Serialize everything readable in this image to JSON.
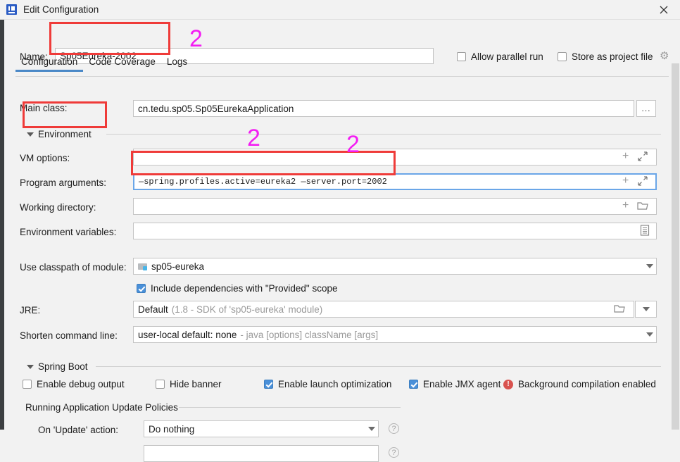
{
  "window": {
    "title": "Edit Configuration",
    "app_icon": "intellij-idea-icon",
    "close_icon": "close-icon"
  },
  "name_row": {
    "label": "Name:",
    "value": "Sp05Eureka-2002"
  },
  "top_options": [
    {
      "label": "Allow parallel run",
      "checked": false
    },
    {
      "label": "Store as project file",
      "checked": false
    }
  ],
  "gear_icon": "gear-icon",
  "tabs": [
    {
      "label": "Configuration",
      "active": true
    },
    {
      "label": "Code Coverage",
      "active": false
    },
    {
      "label": "Logs",
      "active": false
    }
  ],
  "fields": {
    "main_class": {
      "label": "Main class:",
      "value": "cn.tedu.sp05.Sp05EurekaApplication",
      "browse_label": "..."
    },
    "environment_section": {
      "label": "Environment"
    },
    "vm_options": {
      "label": "VM options:",
      "value": ""
    },
    "program_arguments": {
      "label": "Program arguments:",
      "value": "—spring.profiles.active=eureka2  —server.port=2002"
    },
    "working_directory": {
      "label": "Working directory:",
      "value": ""
    },
    "environment_variables": {
      "label": "Environment variables:",
      "value": ""
    },
    "use_classpath": {
      "label": "Use classpath of module:",
      "value": "sp05-eureka"
    },
    "include_dependencies": {
      "label": "Include dependencies with \"Provided\" scope",
      "checked": true
    },
    "jre": {
      "label": "JRE:",
      "value": "Default",
      "hint": "(1.8 - SDK of 'sp05-eureka' module)"
    },
    "shorten_command_line": {
      "label": "Shorten command line:",
      "value": "user-local default: none",
      "hint": "- java [options] className [args]"
    }
  },
  "spring_boot": {
    "section_label": "Spring Boot",
    "checkboxes": [
      {
        "label": "Enable debug output",
        "checked": false
      },
      {
        "label": "Hide banner",
        "checked": false
      },
      {
        "label": "Enable launch optimization",
        "checked": true
      },
      {
        "label": "Enable JMX agent",
        "checked": true
      }
    ],
    "warning": {
      "icon": "error-icon",
      "text": "Background compilation enabled"
    },
    "update_policies": {
      "section_label": "Running Application Update Policies",
      "on_update_label": "On 'Update' action:",
      "on_update_value": "Do nothing"
    }
  },
  "icons": {
    "plus": "+",
    "expand": "expand-icon",
    "folder": "folder-icon",
    "document": "document-icon",
    "dropdown": "chevron-down-icon",
    "help": "help-icon"
  },
  "annotations": {
    "marker_label": "2",
    "markers": [
      {
        "id": "marker-name"
      },
      {
        "id": "marker-vm-options"
      },
      {
        "id": "marker-program-arguments"
      }
    ],
    "boxes": [
      {
        "id": "highlight-name-field"
      },
      {
        "id": "highlight-environment-section"
      },
      {
        "id": "highlight-program-arguments"
      }
    ],
    "color": "#ef3b39",
    "marker_color": "#f31ef3"
  }
}
